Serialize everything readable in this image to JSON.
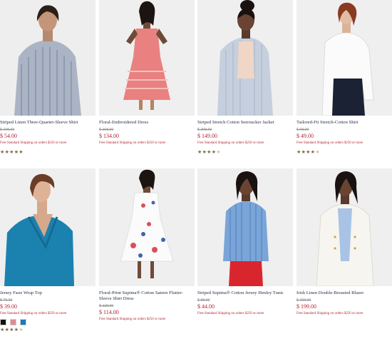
{
  "products": [
    {
      "title": "Striped Linen Three-Quarter-Sleeve Shirt",
      "old_price": "$ 108.00",
      "price": "$ 54.00",
      "shipping": "Free Standard Shipping on orders $250 or more",
      "stars": "★★★★★",
      "stars_off": "",
      "rating": 5
    },
    {
      "title": "Floral-Embroidered Dress",
      "old_price": "$ 268.00",
      "price": "$ 134.00",
      "shipping": "Free Standard Shipping on orders $250 or more",
      "stars": "",
      "stars_off": "",
      "rating": null
    },
    {
      "title": "Striped Stretch Cotton Seersucker Jacket",
      "old_price": "$ 298.00",
      "price": "$ 149.00",
      "shipping": "Free Standard Shipping on orders $250 or more",
      "stars": "★★★★",
      "stars_off": "★",
      "rating": 4
    },
    {
      "title": "Tailored-Fit Stretch-Cotton Shirt",
      "old_price": "$ 98.00",
      "price": "$ 49.00",
      "shipping": "Free Standard Shipping on orders $250 or more",
      "stars": "★★★★",
      "stars_off": "★",
      "rating": 4
    },
    {
      "title": "Jersey Faux Wrap Top",
      "old_price": "$ 78.00",
      "price": "$ 39.00",
      "shipping": "Free Standard Shipping on orders $250 or more",
      "stars": "★★★★",
      "stars_off": "★",
      "rating": 4,
      "swatches": [
        "#111111",
        "#e08a92",
        "#1d78b9"
      ]
    },
    {
      "title": "Floral-Print Supima® Cotton Sateen Flutter-Sleeve Shirt Dress",
      "old_price": "$ 228.00",
      "price": "$ 114.00",
      "shipping": "Free Standard Shipping on orders $250 or more",
      "stars": "",
      "stars_off": "",
      "rating": null
    },
    {
      "title": "Striped Supima® Cotton Jersey Henley Tunic",
      "old_price": "$ 88.00",
      "price": "$ 44.00",
      "shipping": "Free Standard Shipping on orders $250 or more",
      "stars": "",
      "stars_off": "",
      "rating": null
    },
    {
      "title": "Irish Linen Double-Breasted Blazer",
      "old_price": "$ 398.00",
      "price": "$ 199.00",
      "shipping": "Free Standard Shipping on orders $250 or more",
      "stars": "",
      "stars_off": "",
      "rating": null
    }
  ],
  "colors": {
    "sale_red": "#b4232f",
    "title_navy": "#1f2a44",
    "star_gold": "#7c6a45"
  }
}
